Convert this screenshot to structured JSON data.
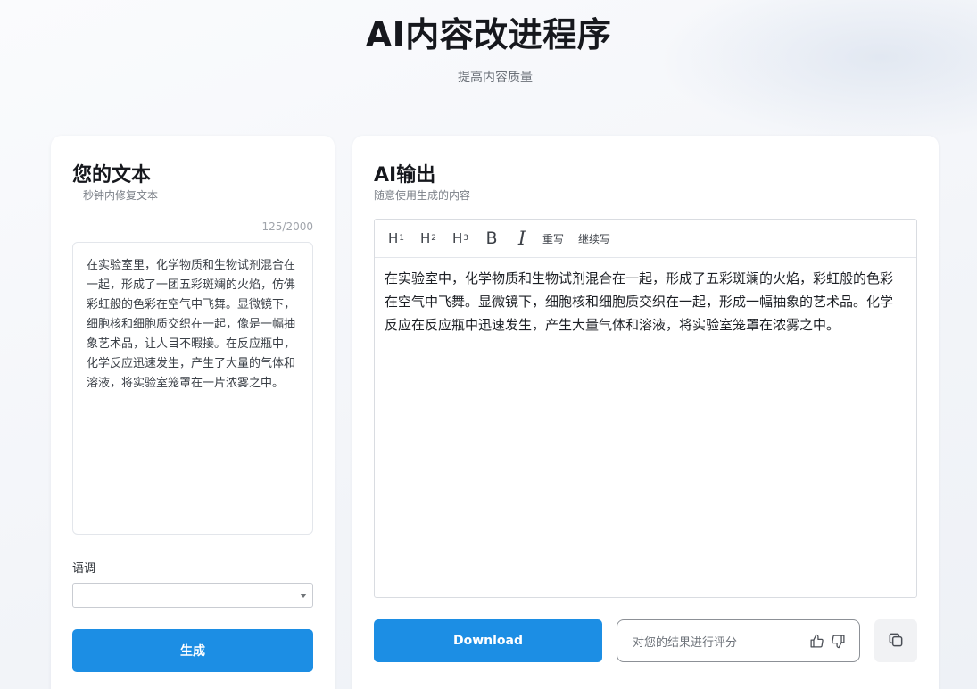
{
  "header": {
    "title": "AI内容改进程序",
    "subtitle": "提高内容质量"
  },
  "input_panel": {
    "title": "您的文本",
    "subtitle": "一秒钟内修复文本",
    "char_count": "125/2000",
    "text": "在实验室里，化学物质和生物试剂混合在一起，形成了一团五彩斑斓的火焰，仿佛彩虹般的色彩在空气中飞舞。显微镜下，细胞核和细胞质交织在一起，像是一幅抽象艺术品，让人目不暇接。在反应瓶中，化学反应迅速发生，产生了大量的气体和溶液，将实验室笼罩在一片浓雾之中。",
    "tone_label": "语调",
    "tone_value": "",
    "generate_label": "生成"
  },
  "output_panel": {
    "title": "AI输出",
    "subtitle": "随意使用生成的内容",
    "toolbar": {
      "h1": "H",
      "h2": "H",
      "h3": "H",
      "h1_level": "1",
      "h2_level": "2",
      "h3_level": "3",
      "bold": "B",
      "italic": "I",
      "rewrite": "重写",
      "continue": "继续写"
    },
    "output_text": "在实验室中，化学物质和生物试剂混合在一起，形成了五彩斑斓的火焰，彩虹般的色彩在空气中飞舞。显微镜下，细胞核和细胞质交织在一起，形成一幅抽象的艺术品。化学反应在反应瓶中迅速发生，产生大量气体和溶液，将实验室笼罩在浓雾之中。",
    "download_label": "Download",
    "rating_placeholder": "对您的结果进行评分",
    "icons": {
      "thumbs_up": "thumbs-up-icon",
      "thumbs_down": "thumbs-down-icon",
      "copy": "copy-icon"
    }
  },
  "colors": {
    "accent": "#1c8ee4",
    "background": "#f3f5f9",
    "card": "#ffffff"
  }
}
